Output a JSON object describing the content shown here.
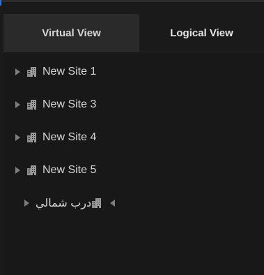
{
  "tabs": [
    {
      "label": "Virtual View",
      "active": true
    },
    {
      "label": "Logical View",
      "active": false
    }
  ],
  "tree": {
    "items": [
      {
        "label": "New Site 1",
        "icon": "building-icon",
        "expanded": false
      },
      {
        "label": "New Site 3",
        "icon": "building-icon",
        "expanded": false
      },
      {
        "label": "New Site 4",
        "icon": "building-icon",
        "expanded": false
      },
      {
        "label": "New Site 5",
        "icon": "building-icon",
        "expanded": false
      },
      {
        "label": "درب شمالي",
        "icon": "building-icon",
        "expanded": false,
        "direction": "rtl"
      }
    ]
  },
  "colors": {
    "background": "#1a1a1a",
    "panel": "#181818",
    "active_tab": "#2a2a2a",
    "text": "#d6d6d6",
    "icon": "#8c8c8c",
    "accent": "#1e78ff"
  }
}
